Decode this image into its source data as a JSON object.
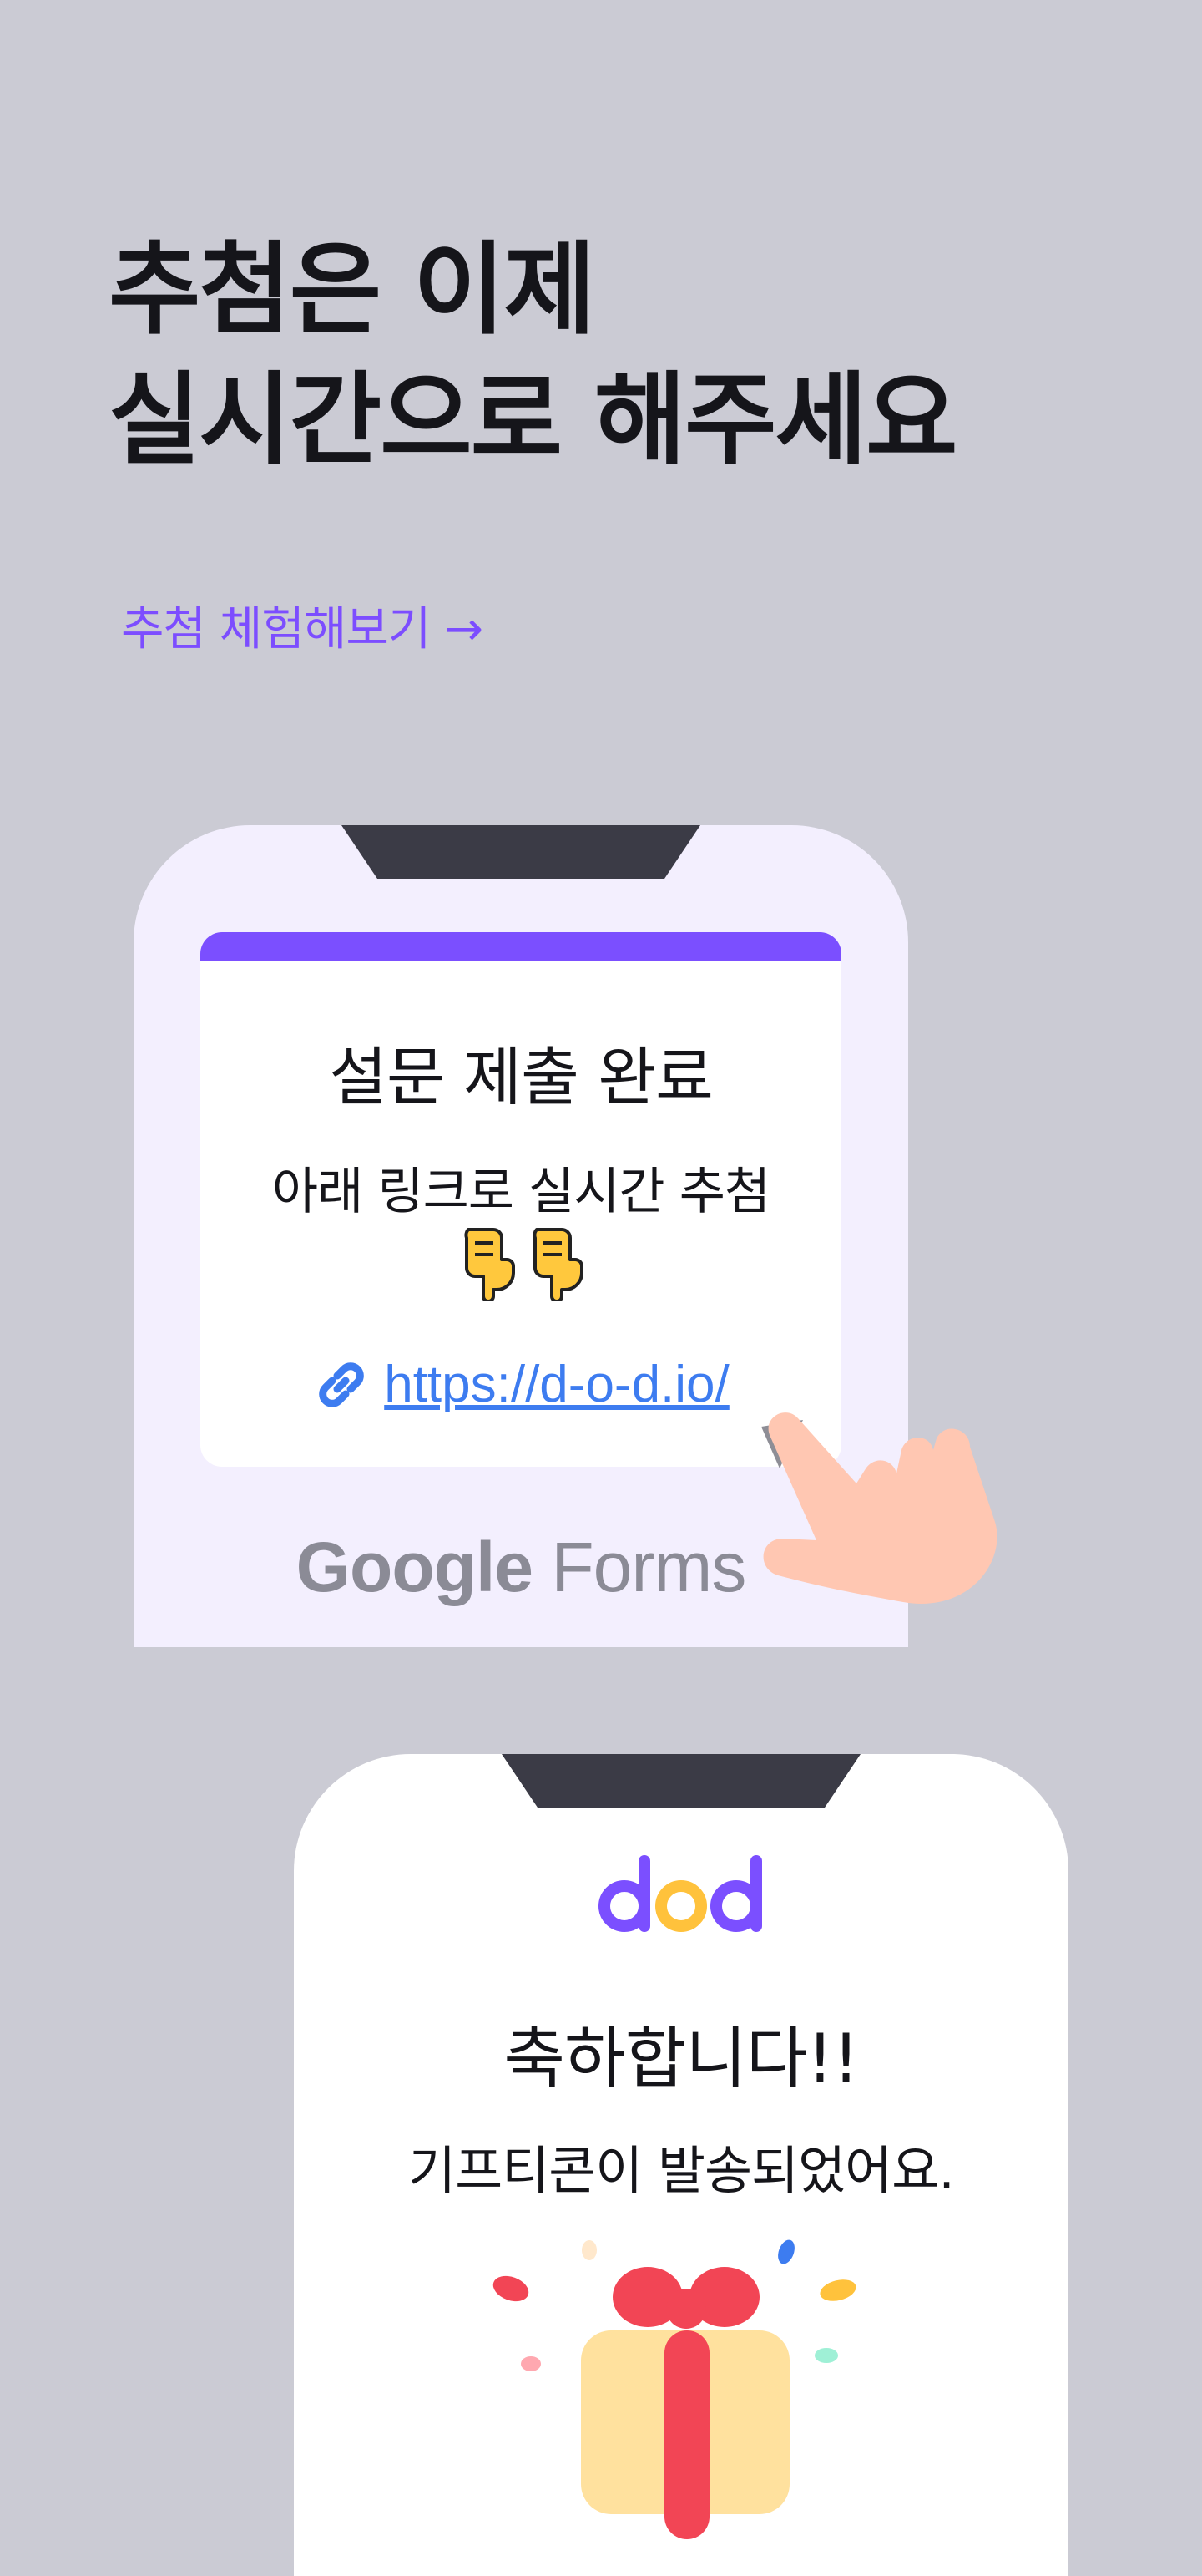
{
  "hero": {
    "line1": "추첨은 이제",
    "line2": "실시간으로 해주세요",
    "cta_label": "추첨 체험해보기 →"
  },
  "form_screen": {
    "title": "설문 제출 완료",
    "subtitle": "아래 링크로 실시간 추첨",
    "link": "https://d-o-d.io/",
    "brand_g": "Google",
    "brand_f": "Forms",
    "icons": [
      "pointing-down-icon",
      "pointing-down-icon",
      "link-icon",
      "tap-hand-icon"
    ]
  },
  "result_screen": {
    "logo": "dod",
    "title": "축하합니다!!",
    "message": "기프티콘이 발송되었어요.",
    "icons": [
      "gift-icon",
      "confetti-icon"
    ]
  },
  "colors": {
    "background": "#cbcbd4",
    "accent": "#7c4dff",
    "link": "#3d7cf0",
    "gift_ribbon": "#f24555",
    "gift_box": "#ffe19e",
    "logo_yellow": "#ffc23c"
  }
}
